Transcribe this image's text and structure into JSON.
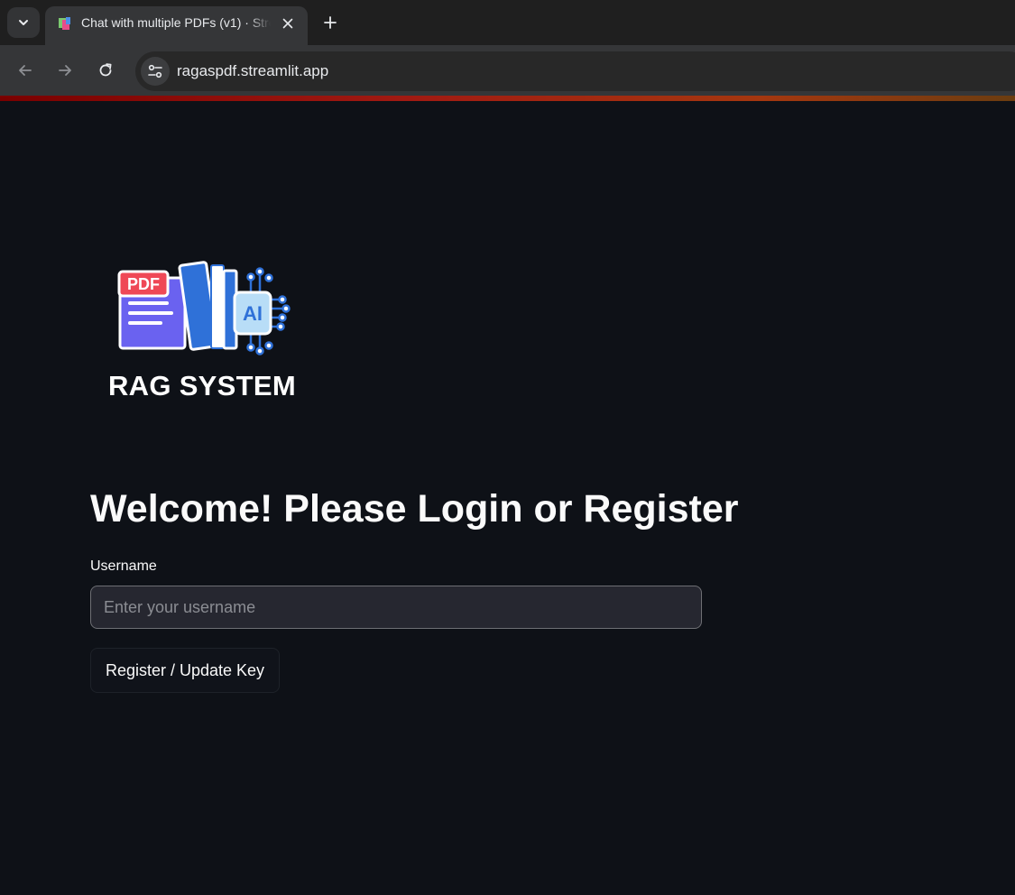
{
  "browser": {
    "tab": {
      "title": "Chat with multiple PDFs (v1) · Streamlit"
    },
    "address_bar": {
      "url": "ragaspdf.streamlit.app"
    },
    "icons": {
      "tab_search": "chevron-down-icon",
      "tab_close": "close-icon",
      "new_tab": "plus-icon",
      "back": "arrow-left-icon",
      "forward": "arrow-right-icon",
      "reload": "reload-icon",
      "site_info": "tune-icon"
    }
  },
  "logo": {
    "badge_text": "PDF",
    "ai_text": "AI",
    "caption": "RAG SYSTEM"
  },
  "login": {
    "heading": "Welcome! Please Login or Register",
    "username_label": "Username",
    "username_placeholder": "Enter your username",
    "username_value": "",
    "register_button_label": "Register / Update Key"
  },
  "colors": {
    "page_background": "#0e1117",
    "text": "#fafafa",
    "input_background": "#262730",
    "pdf_badge": "#ef4856",
    "document": "#6a62f0",
    "book_blue": "#2f71d8",
    "ai_chip": "#b8ddf7"
  }
}
